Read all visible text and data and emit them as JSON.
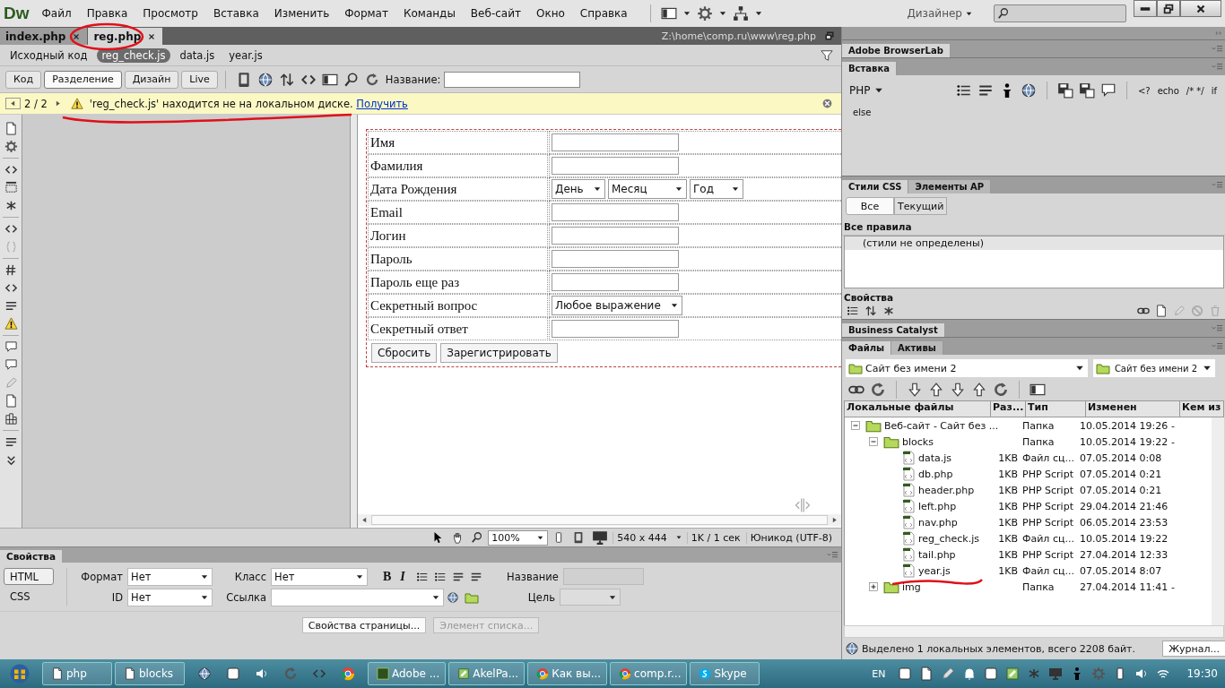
{
  "menu": {
    "logo": "Dw",
    "items": [
      "Файл",
      "Правка",
      "Просмотр",
      "Вставка",
      "Изменить",
      "Формат",
      "Команды",
      "Веб-сайт",
      "Окно",
      "Справка"
    ],
    "workspace": "Дизайнер"
  },
  "doc_tabs": [
    {
      "label": "index.php",
      "selected": false
    },
    {
      "label": "reg.php",
      "selected": true
    }
  ],
  "file_path": "Z:\\home\\comp.ru\\www\\reg.php",
  "related_files": [
    {
      "label": "Исходный код",
      "selected": false
    },
    {
      "label": "reg_check.js",
      "selected": true
    },
    {
      "label": "data.js",
      "selected": false
    },
    {
      "label": "year.js",
      "selected": false
    }
  ],
  "view_buttons": [
    {
      "label": "Код",
      "selected": false
    },
    {
      "label": "Разделение",
      "selected": true
    },
    {
      "label": "Дизайн",
      "selected": false
    },
    {
      "label": "Live",
      "selected": false
    }
  ],
  "title_label": "Название:",
  "info_bar": {
    "counter": "2 / 2",
    "message": "'reg_check.js' находится не на локальном диске.",
    "link": "Получить"
  },
  "form_rows": [
    {
      "label": "Имя",
      "kind": "text"
    },
    {
      "label": "Фамилия",
      "kind": "text"
    },
    {
      "label": "Дата Рождения",
      "kind": "date",
      "selects": [
        "День",
        "Месяц",
        "Год"
      ]
    },
    {
      "label": "Email",
      "kind": "text"
    },
    {
      "label": "Логин",
      "kind": "text"
    },
    {
      "label": "Пароль",
      "kind": "text"
    },
    {
      "label": "Пароль еще раз",
      "kind": "text"
    },
    {
      "label": "Секретный вопрос",
      "kind": "select",
      "value": "Любое выражение"
    },
    {
      "label": "Секретный ответ",
      "kind": "text"
    }
  ],
  "form_buttons": [
    "Сбросить",
    "Зарегистрировать"
  ],
  "status_bar": {
    "zoom": "100%",
    "size": "540 x 444",
    "speed": "1K / 1 сек",
    "encoding": "Юникод (UTF-8)"
  },
  "properties": {
    "title": "Свойства",
    "modes": [
      {
        "label": "HTML",
        "selected": true
      },
      {
        "label": "CSS",
        "selected": false
      }
    ],
    "row1": [
      {
        "label": "Формат",
        "value": "Нет",
        "kind": "select"
      },
      {
        "label": "Класс",
        "value": "Нет",
        "kind": "select"
      }
    ],
    "row2": [
      {
        "label": "ID",
        "value": "Нет",
        "kind": "select"
      },
      {
        "label": "Ссылка",
        "kind": "link"
      }
    ],
    "format_buttons": [
      "B",
      "I"
    ],
    "side_fields": [
      {
        "label": "Название",
        "kind": "input"
      },
      {
        "label": "Цель",
        "kind": "select"
      }
    ],
    "buttons": [
      {
        "label": "Свойства страницы...",
        "disabled": false
      },
      {
        "label": "Элемент списка...",
        "disabled": true
      }
    ]
  },
  "panels": {
    "browserlab": "Adobe BrowserLab",
    "insert": {
      "tab": "Вставка",
      "category": "PHP",
      "code_buttons": [
        "<?",
        "echo",
        "/* */",
        "if",
        "else"
      ]
    },
    "css": {
      "tabs": [
        {
          "label": "Стили CSS",
          "selected": true
        },
        {
          "label": "Элементы AP",
          "selected": false
        }
      ],
      "filters": [
        {
          "label": "Все",
          "selected": true
        },
        {
          "label": "Текущий",
          "selected": false
        }
      ],
      "header": "Все правила",
      "rule": "(стили не определены)",
      "properties": "Свойства"
    },
    "business_catalyst": "Business Catalyst"
  },
  "files": {
    "tabs": [
      {
        "label": "Файлы",
        "selected": true
      },
      {
        "label": "Активы",
        "selected": false
      }
    ],
    "site": "Сайт без имени 2",
    "server": "Сайт без имени 2",
    "columns": [
      "Локальные файлы",
      "Раз...",
      "Тип",
      "Изменен",
      "Кем из"
    ],
    "tree": [
      {
        "name": "Веб-сайт - Сайт без ...",
        "type": "Папка",
        "modified": "10.05.2014 19:26",
        "by": "-",
        "kind": "folder",
        "expanded": true,
        "children": [
          {
            "name": "blocks",
            "type": "Папка",
            "modified": "10.05.2014 19:22",
            "by": "-",
            "kind": "folder",
            "expanded": true,
            "children": [
              {
                "name": "data.js",
                "size": "1KB",
                "type": "Файл сц...",
                "modified": "07.05.2014 0:08",
                "kind": "file"
              },
              {
                "name": "db.php",
                "size": "1KB",
                "type": "PHP Script",
                "modified": "07.05.2014 0:21",
                "kind": "file"
              },
              {
                "name": "header.php",
                "size": "1KB",
                "type": "PHP Script",
                "modified": "07.05.2014 0:21",
                "kind": "file"
              },
              {
                "name": "left.php",
                "size": "1KB",
                "type": "PHP Script",
                "modified": "29.04.2014 21:46",
                "kind": "file"
              },
              {
                "name": "nav.php",
                "size": "1KB",
                "type": "PHP Script",
                "modified": "06.05.2014 23:53",
                "kind": "file"
              },
              {
                "name": "reg_check.js",
                "size": "1KB",
                "type": "Файл сц...",
                "modified": "10.05.2014 19:22",
                "kind": "file"
              },
              {
                "name": "tail.php",
                "size": "1KB",
                "type": "PHP Script",
                "modified": "27.04.2014 12:33",
                "kind": "file"
              },
              {
                "name": "year.js",
                "size": "1KB",
                "type": "Файл сц...",
                "modified": "07.05.2014 8:07",
                "kind": "file"
              }
            ]
          },
          {
            "name": "img",
            "type": "Папка",
            "modified": "27.04.2014 11:41",
            "by": "-",
            "kind": "folder",
            "expanded": false
          }
        ]
      }
    ],
    "status": "Выделено 1 локальных элементов, всего 2208 байт.",
    "log_button": "Журнал..."
  },
  "taskbar": {
    "tasks": [
      {
        "label": "php",
        "kind": "folder"
      },
      {
        "label": "blocks",
        "kind": "folder"
      },
      {
        "label": "Adobe ...",
        "kind": "dw"
      },
      {
        "label": "AkelPa...",
        "kind": "editor"
      },
      {
        "label": "Как вы...",
        "kind": "browser"
      },
      {
        "label": "comp.r...",
        "kind": "browser"
      },
      {
        "label": "Skype",
        "kind": "skype"
      }
    ],
    "language": "EN",
    "time": "19:30"
  }
}
